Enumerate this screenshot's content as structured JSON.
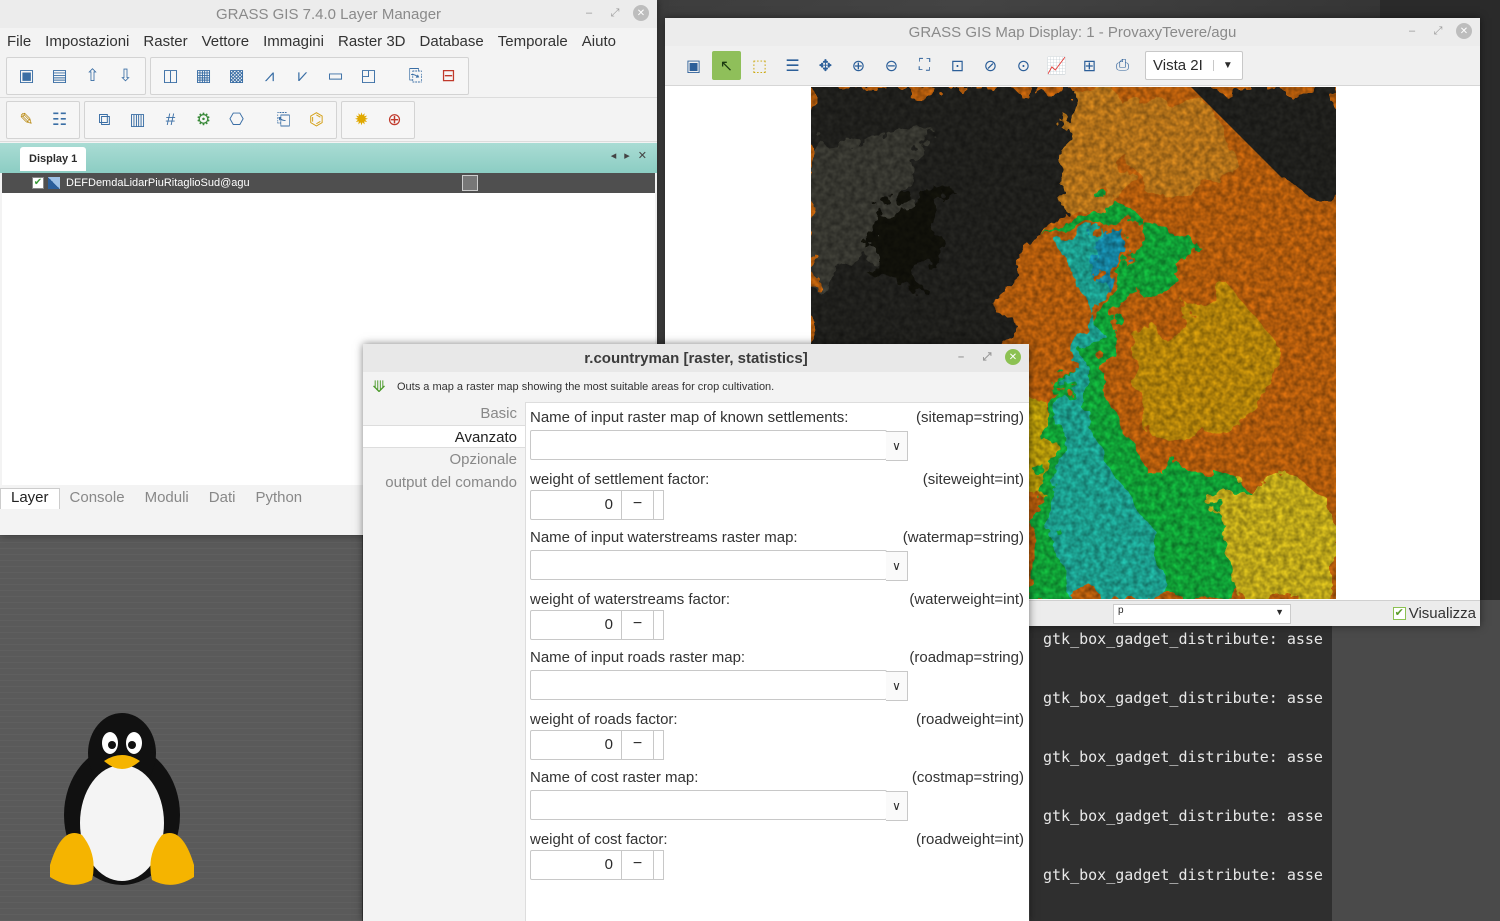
{
  "layer_manager": {
    "title": "GRASS GIS 7.4.0 Layer Manager",
    "menu": [
      "File",
      "Impostazioni",
      "Raster",
      "Vettore",
      "Immagini",
      "Raster 3D",
      "Database",
      "Temporale",
      "Aiuto"
    ],
    "display_tab": "Display 1",
    "layer_name": "DEFDemdaLidarPiuRitaglioSud@agu",
    "bottom_tabs": [
      "Layer",
      "Console",
      "Moduli",
      "Dati",
      "Python"
    ]
  },
  "map_display": {
    "title": "GRASS GIS Map Display: 1 - ProvaxyTevere/agu",
    "view_select": "Vista 2I",
    "status_combo": "p",
    "render_label": "Visualizza"
  },
  "module": {
    "title": "r.countryman [raster, statistics]",
    "description": "Outs a map a raster map showing the most suitable areas for crop cultivation.",
    "sections": [
      "Basic",
      "Avanzato",
      "Opzionale",
      "output del comando"
    ],
    "active_section": 1,
    "params": [
      {
        "label": "Name of input raster map of known settlements:",
        "key": "(sitemap=string)",
        "type": "combo",
        "value": ""
      },
      {
        "label": "weight of settlement factor:",
        "key": "(siteweight=int)",
        "type": "spin",
        "value": "0"
      },
      {
        "label": "Name of input waterstreams raster map:",
        "key": "(watermap=string)",
        "type": "combo",
        "value": ""
      },
      {
        "label": "weight of waterstreams factor:",
        "key": "(waterweight=int)",
        "type": "spin",
        "value": "0"
      },
      {
        "label": "Name of input roads raster map:",
        "key": "(roadmap=string)",
        "type": "combo",
        "value": ""
      },
      {
        "label": "weight of roads factor:",
        "key": "(roadweight=int)",
        "type": "spin",
        "value": "0"
      },
      {
        "label": "Name of cost raster map:",
        "key": "(costmap=string)",
        "type": "combo",
        "value": ""
      },
      {
        "label": "weight of cost factor:",
        "key": "(roadweight=int)",
        "type": "spin",
        "value": "0"
      }
    ],
    "minus_glyph": "−"
  },
  "terminal": {
    "lines": [
      "gtk_box_gadget_distribute: asse",
      "gtk_box_gadget_distribute: asse",
      "gtk_box_gadget_distribute: asse",
      "gtk_box_gadget_distribute: asse",
      "gtk_box_gadget_distribute: asse"
    ]
  },
  "colors": {
    "tabstrip": "#8ccdc3",
    "active_tool": "#8fbf5a",
    "close_active": "#8cc152"
  }
}
